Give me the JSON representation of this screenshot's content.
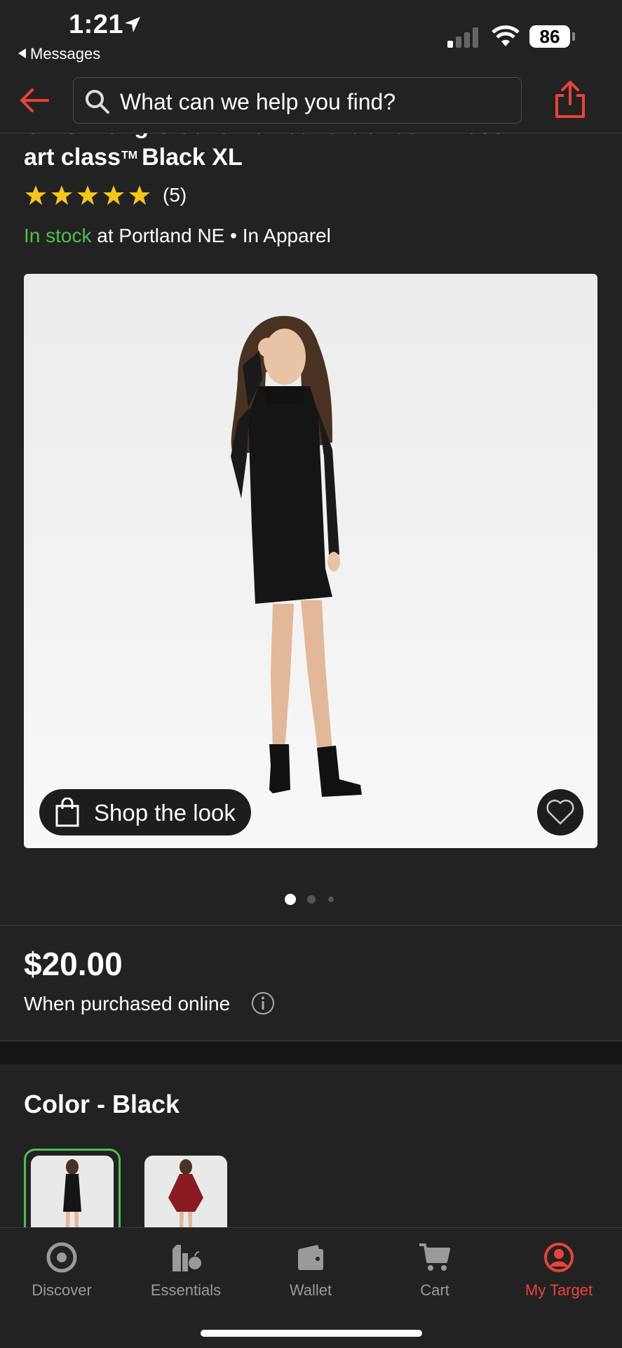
{
  "status_bar": {
    "time": "1:21",
    "back_app": "Messages",
    "battery": "86"
  },
  "header": {
    "search_placeholder": "What can we help you find?"
  },
  "product": {
    "title_line1": "Girls' Long Sleeve Velvet Turtleneck Dress",
    "title_line2_a": "art class",
    "title_tm": "TM",
    "title_line2_b": "Black XL",
    "rating_stars": 5,
    "rating_count": "(5)",
    "stock_status": "In stock",
    "stock_location": " at Portland NE • In Apparel",
    "shop_look_label": "Shop the look",
    "image_count": 3,
    "active_image": 1,
    "price": "$20.00",
    "price_note": "When purchased online",
    "color_heading": "Color - Black"
  },
  "tabs": [
    {
      "label": "Discover",
      "icon": "target-icon"
    },
    {
      "label": "Essentials",
      "icon": "essentials-icon"
    },
    {
      "label": "Wallet",
      "icon": "wallet-icon"
    },
    {
      "label": "Cart",
      "icon": "cart-icon"
    },
    {
      "label": "My Target",
      "icon": "profile-icon",
      "active": true
    }
  ],
  "colors": {
    "accent": "#e8433a",
    "stock_green": "#4cc24c",
    "background": "#222222"
  }
}
